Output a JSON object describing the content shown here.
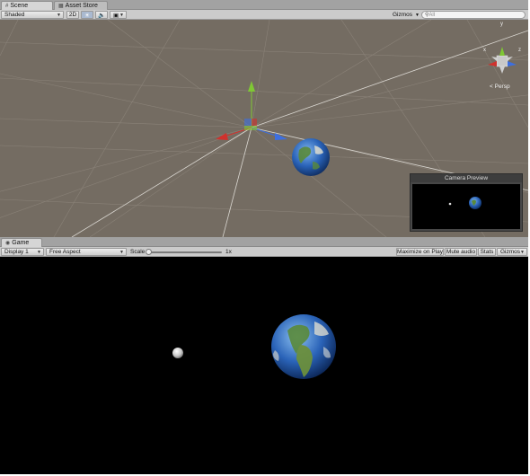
{
  "scene_window": {
    "tabs": [
      {
        "label": "Scene",
        "icon": "scene-icon",
        "active": true
      },
      {
        "label": "Asset Store",
        "icon": "store-icon",
        "active": false
      }
    ],
    "toolbar": {
      "shading_mode": "Shaded",
      "mode_2d": "2D",
      "lighting_icon": "sun-icon",
      "audio_icon": "speaker-icon",
      "effects_icon": "image-icon",
      "gizmos_label": "Gizmos",
      "search_placeholder": "All"
    },
    "viewport": {
      "background": "#746c62",
      "orientation_gizmo": {
        "y": "y",
        "x": "x",
        "z": "z",
        "projection": "Persp"
      }
    },
    "camera_preview": {
      "title": "Camera Preview"
    }
  },
  "game_window": {
    "tab": {
      "label": "Game",
      "icon": "game-icon"
    },
    "toolbar": {
      "display": "Display 1",
      "aspect": "Free Aspect",
      "scale_label": "Scale",
      "scale_value": "1x",
      "scale_level": 0,
      "maximize_on_play": "Maximize on Play",
      "mute_audio": "Mute audio",
      "stats": "Stats",
      "gizmos_label": "Gizmos"
    },
    "viewport": {
      "background": "#000000"
    }
  },
  "colors": {
    "axis_x": "#d0312d",
    "axis_y": "#7fc734",
    "axis_z": "#3d6fe0",
    "earth_ocean": "#2a63b8",
    "earth_land": "#5a8a3a"
  }
}
